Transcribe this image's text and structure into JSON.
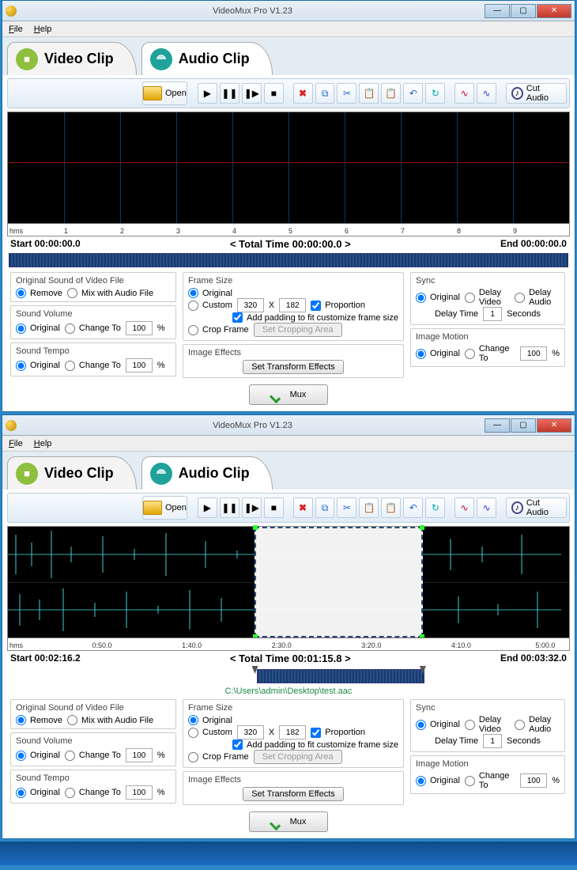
{
  "app_title": "VideoMux Pro V1.23",
  "menus": {
    "file": "File",
    "help": "Help"
  },
  "tabs": {
    "video": "Video Clip",
    "audio": "Audio Clip"
  },
  "toolbar": {
    "open": "Open",
    "cut_audio": "Cut Audio"
  },
  "ruler": {
    "unit": "hms",
    "ticks": [
      "1",
      "2",
      "3",
      "4",
      "5",
      "6",
      "7",
      "8",
      "9"
    ]
  },
  "ruler2": {
    "unit": "hms",
    "ticks": [
      "0:50.0",
      "1:40.0",
      "2:30.0",
      "3:20.0",
      "4:10.0",
      "5:00.0"
    ]
  },
  "win1": {
    "start": "Start 00:00:00.0",
    "total": "< Total Time 00:00:00.0 >",
    "end": "End 00:00:00.0",
    "filepath": ""
  },
  "win2": {
    "start": "Start 00:02:16.2",
    "total": "< Total Time 00:01:15.8 >",
    "end": "End 00:03:32.0",
    "filepath": "C:\\Users\\admin\\Desktop\\test.aac"
  },
  "panels": {
    "orig_sound": {
      "title": "Original Sound of Video File",
      "remove": "Remove",
      "mix": "Mix with Audio File"
    },
    "volume": {
      "title": "Sound Volume",
      "original": "Original",
      "change": "Change To",
      "val": "100",
      "pct": "%"
    },
    "tempo": {
      "title": "Sound Tempo",
      "original": "Original",
      "change": "Change To",
      "val": "100",
      "pct": "%"
    },
    "frame": {
      "title": "Frame Size",
      "original": "Original",
      "custom": "Custom",
      "w": "320",
      "x": "X",
      "h": "182",
      "prop": "Proportion",
      "pad": "Add padding to fit customize frame size",
      "crop": "Crop Frame",
      "crop_btn": "Set Cropping Area"
    },
    "effects": {
      "title": "Image Effects",
      "btn": "Set Transform Effects"
    },
    "sync": {
      "title": "Sync",
      "original": "Original",
      "dv": "Delay Video",
      "da": "Delay Audio",
      "dt": "Delay Time",
      "val": "1",
      "sec": "Seconds"
    },
    "motion": {
      "title": "Image Motion",
      "original": "Original",
      "change": "Change To",
      "val": "100",
      "pct": "%"
    },
    "mux": "Mux"
  }
}
